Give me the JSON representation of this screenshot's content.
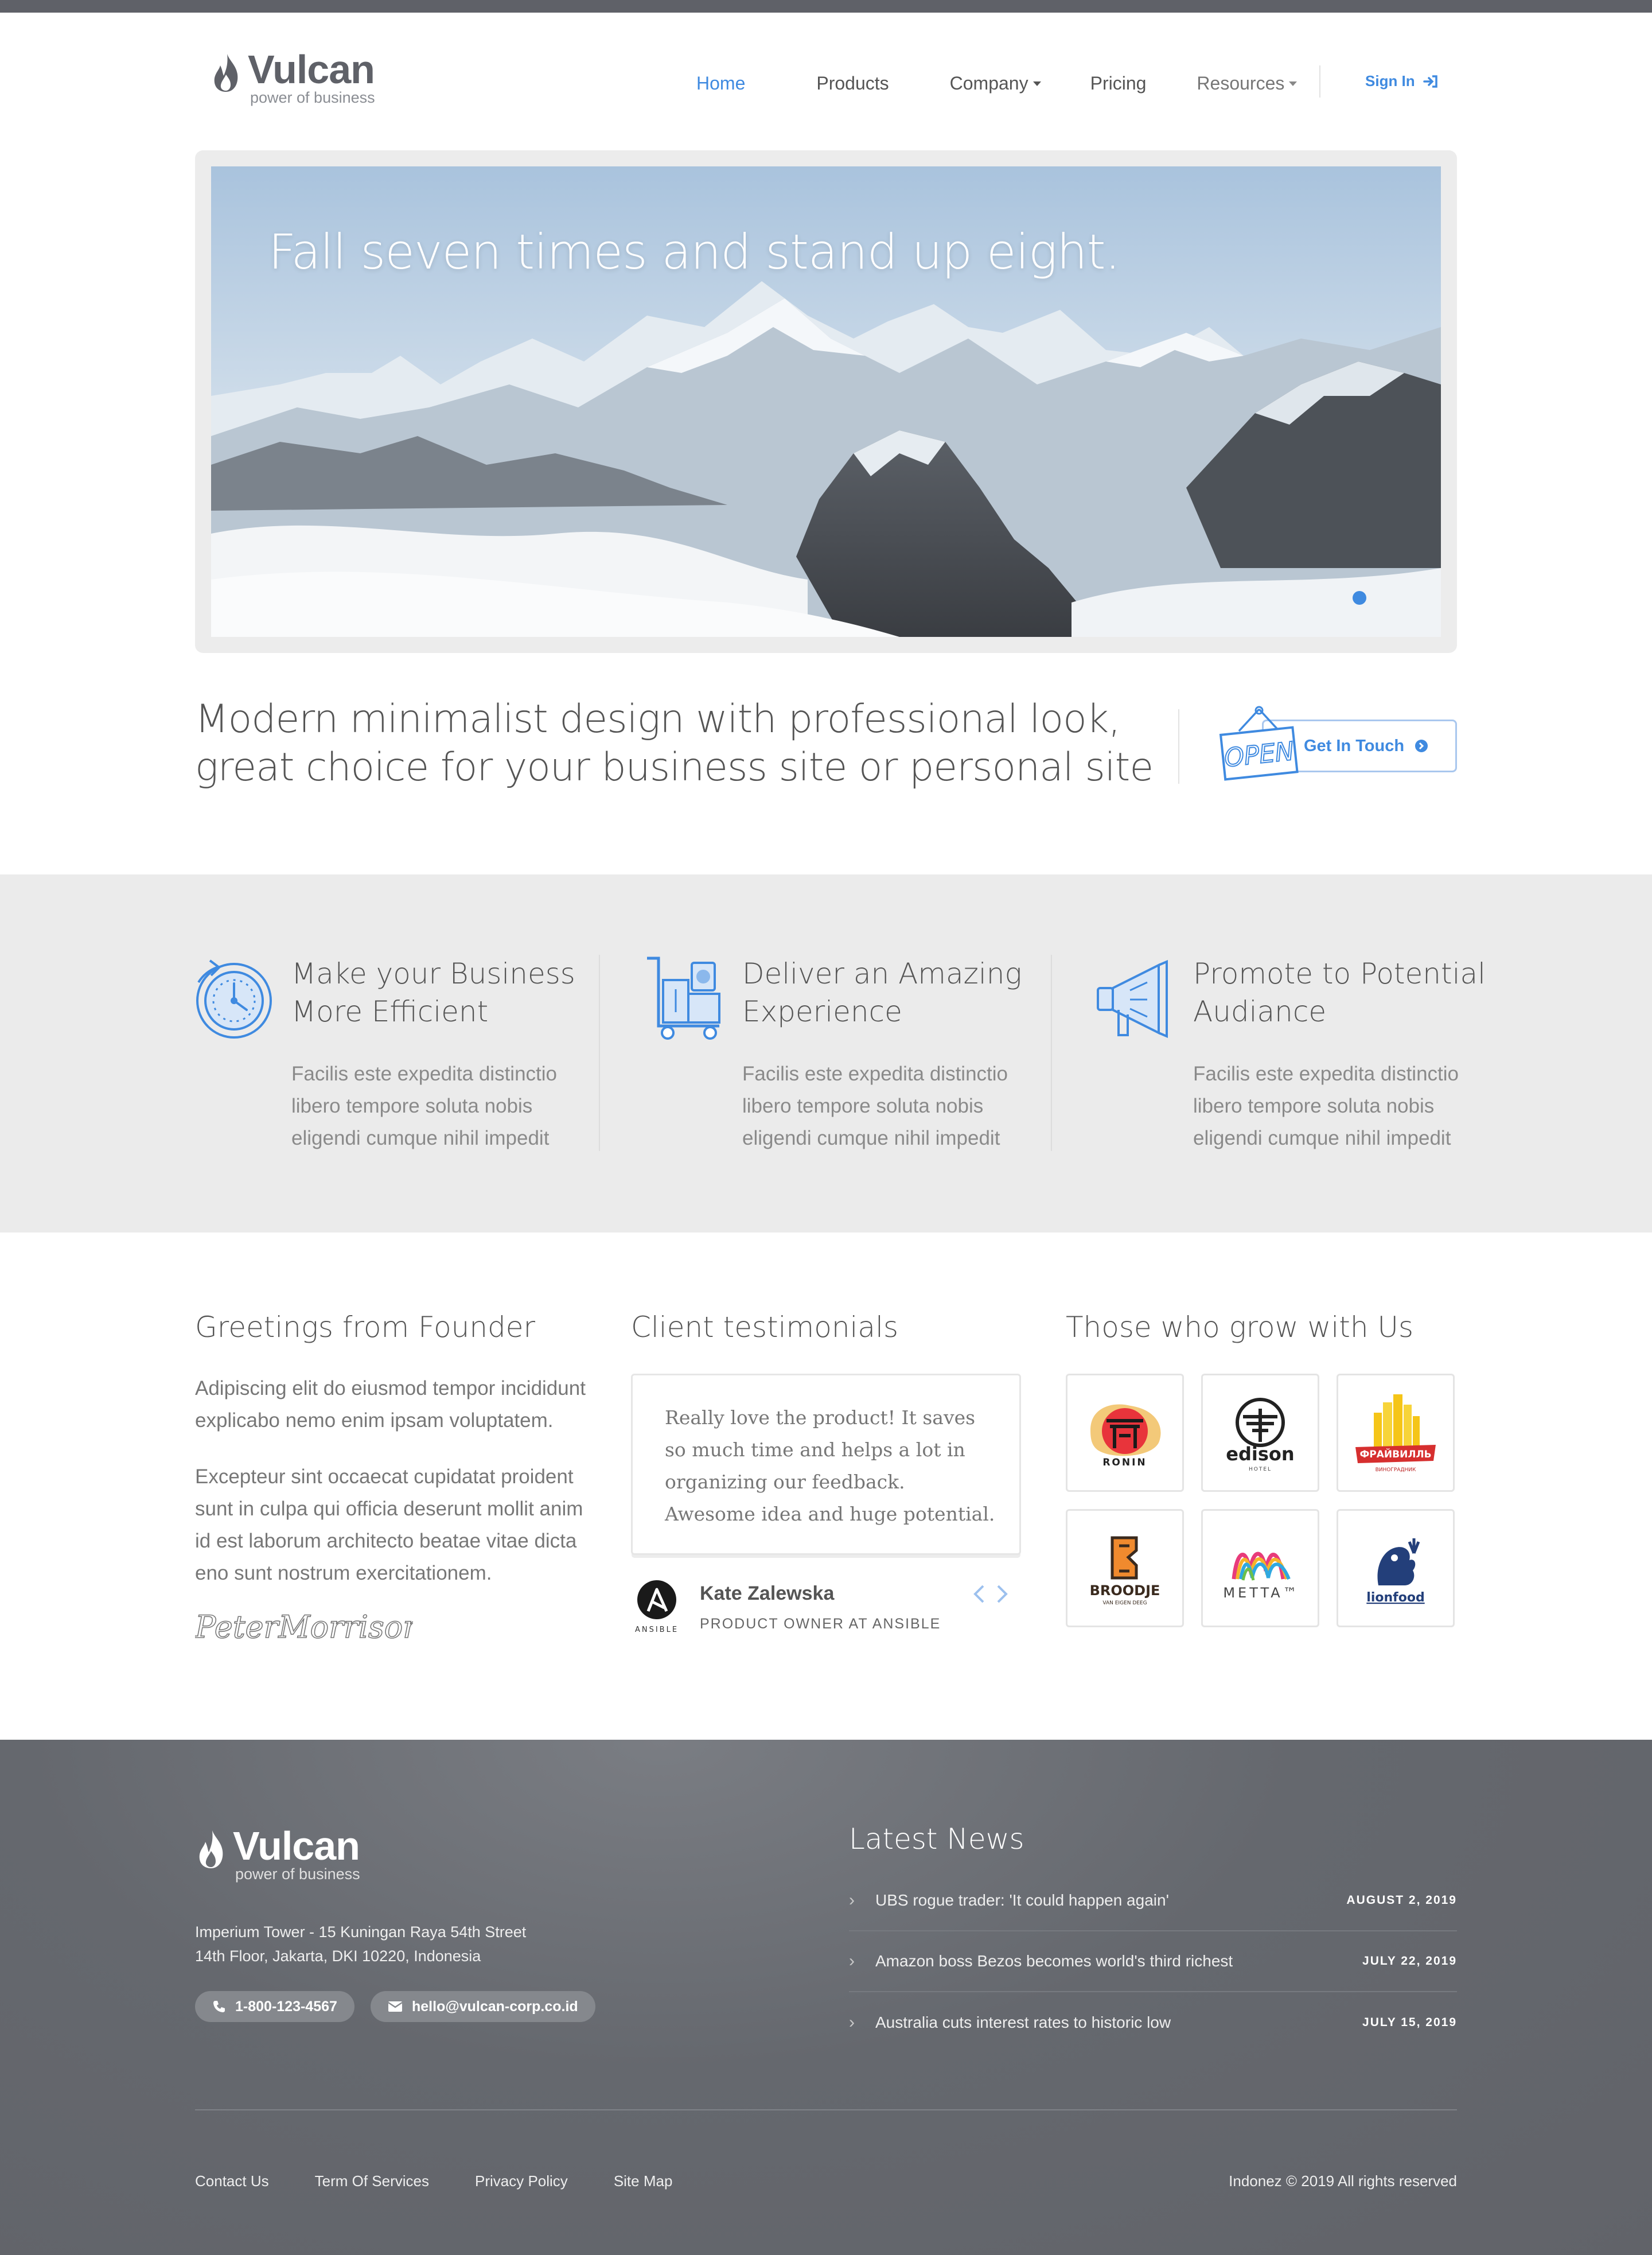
{
  "brand": {
    "name": "Vulcan",
    "tagline": "power of business"
  },
  "nav": {
    "items": [
      {
        "label": "Home",
        "active": true,
        "dropdown": false
      },
      {
        "label": "Products",
        "active": false,
        "dropdown": false
      },
      {
        "label": "Company",
        "active": false,
        "dropdown": true
      },
      {
        "label": "Pricing",
        "active": false,
        "dropdown": false
      },
      {
        "label": "Resources",
        "active": false,
        "dropdown": true
      }
    ],
    "signin": "Sign In"
  },
  "hero": {
    "title": "Fall seven times and stand up eight."
  },
  "intro": {
    "text": "Modern minimalist design with professional look, great choice for your business site or personal site",
    "cta": "Get In Touch",
    "sign_text": "OPEN"
  },
  "features": [
    {
      "icon": "stopwatch-icon",
      "title": "Make your Business More Efficient",
      "text": "Facilis este expedita distinctio libero tempore soluta nobis eligendi cumque nihil impedit"
    },
    {
      "icon": "delivery-cart-icon",
      "title": "Deliver an Amazing Experience",
      "text": "Facilis este expedita distinctio libero tempore soluta nobis eligendi cumque nihil impedit"
    },
    {
      "icon": "megaphone-icon",
      "title": "Promote to Potential Audiance",
      "text": "Facilis este expedita distinctio libero tempore soluta nobis eligendi cumque nihil impedit"
    }
  ],
  "founder": {
    "title": "Greetings from Founder",
    "p1": "Adipiscing elit do eiusmod tempor incididunt explicabo nemo enim ipsam voluptatem.",
    "p2": "Excepteur sint occaecat cupidatat proident sunt in culpa qui officia deserunt mollit anim id est laborum architecto beatae vitae dicta eno sunt nostrum exercitationem.",
    "signature": "PeterMorrison"
  },
  "testimonials": {
    "title": "Client testimonials",
    "quote": "Really love the product! It saves so much time and helps a lot in organizing our feedback. Awesome idea and huge potential.",
    "name": "Kate Zalewska",
    "role": "PRODUCT OWNER AT ANSIBLE",
    "company_logo_text": "ANSIBLE"
  },
  "clients": {
    "title": "Those who grow with Us",
    "logos": [
      {
        "name": "RONIN"
      },
      {
        "name": "edison",
        "sub": "HOTEL"
      },
      {
        "name": "ФРАЙВИЛЛЬ",
        "sub": "ВИНОГРАДНИК"
      },
      {
        "name": "BROODJE",
        "sub": "VAN EIGEN DEEG"
      },
      {
        "name": "METTA™"
      },
      {
        "name": "lionfood"
      }
    ]
  },
  "footer": {
    "address_line1": "Imperium Tower - 15 Kuningan Raya 54th Street",
    "address_line2": "14th Floor, Jakarta, DKI 10220, Indonesia",
    "phone": "1-800-123-4567",
    "email": "hello@vulcan-corp.co.id",
    "news_title": "Latest News",
    "news": [
      {
        "title": "UBS rogue trader: 'It could happen again'",
        "date": "AUGUST 2, 2019"
      },
      {
        "title": "Amazon boss Bezos becomes world's third richest",
        "date": "JULY 22, 2019"
      },
      {
        "title": "Australia cuts interest rates to historic low",
        "date": "JULY 15, 2019"
      }
    ],
    "links": [
      "Contact Us",
      "Term Of Services",
      "Privacy Policy",
      "Site Map"
    ],
    "copyright": "Indonez © 2019 All rights reserved"
  },
  "colors": {
    "accent": "#3f8ae0",
    "footer_bg": "#65686e",
    "features_bg": "#ebebeb"
  }
}
